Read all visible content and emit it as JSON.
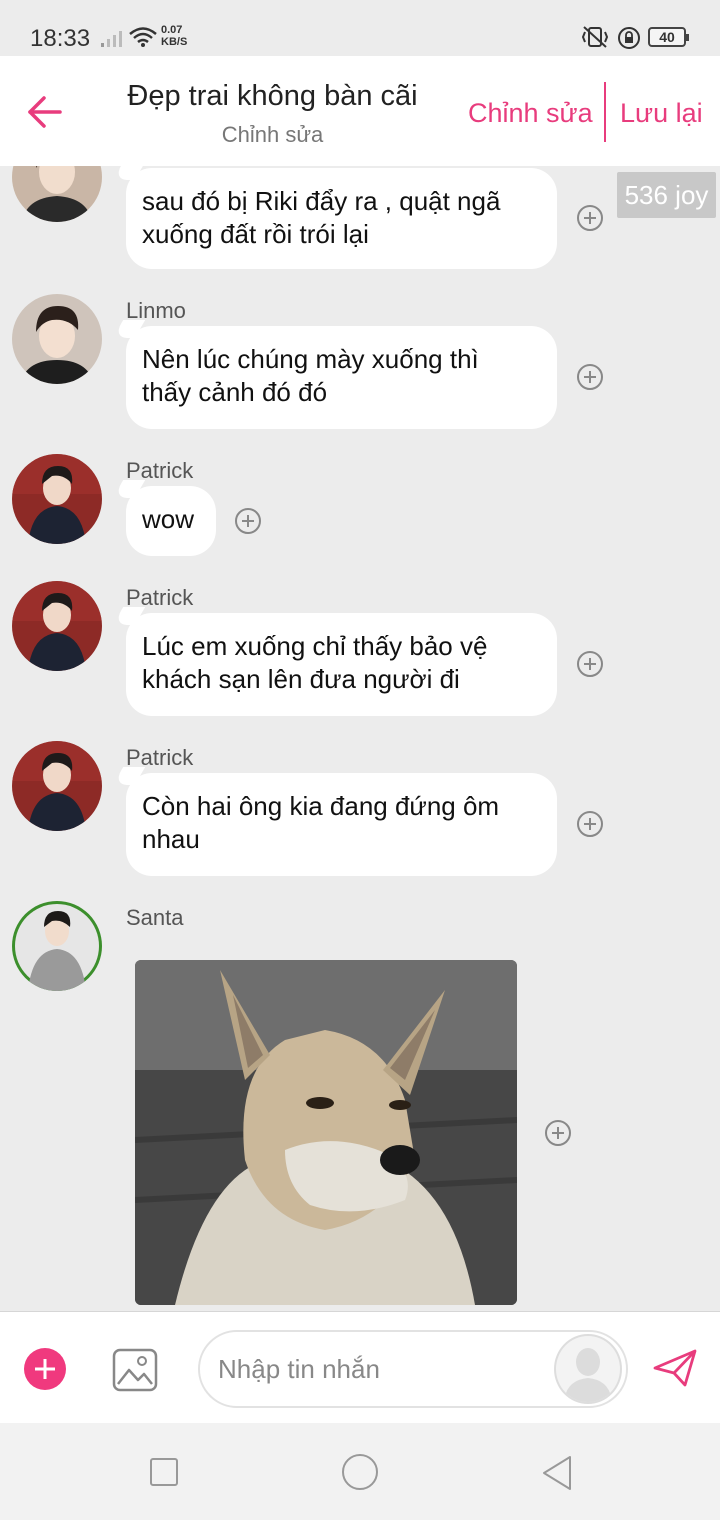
{
  "status_bar": {
    "time": "18:33",
    "net_speed_value": "0.07",
    "net_speed_unit": "KB/S",
    "battery": "40"
  },
  "header": {
    "title": "Đẹp trai không bàn cãi",
    "subtitle": "Chỉnh sửa",
    "edit_label": "Chỉnh sửa",
    "save_label": "Lưu lại"
  },
  "badge": {
    "text": "536 joy"
  },
  "messages": [
    {
      "sender": "",
      "text_line1": "sau đó bị Riki đẩy ra , quật ngã",
      "text_line2": "xuống đất rồi trói lại"
    },
    {
      "sender": "Linmo",
      "text_line1": "Nên lúc chúng mày xuống thì",
      "text_line2": "thấy cảnh đó đó"
    },
    {
      "sender": "Patrick",
      "text_line1": "wow"
    },
    {
      "sender": "Patrick",
      "text_line1": "Lúc em xuống chỉ thấy bảo vệ",
      "text_line2": "khách sạn lên đưa người đi"
    },
    {
      "sender": "Patrick",
      "text_line1": "Còn hai ông kia đang đứng ôm",
      "text_line2": "nhau"
    },
    {
      "sender": "Santa"
    }
  ],
  "input": {
    "placeholder": "Nhập tin nhắn"
  },
  "colors": {
    "accent": "#e83c7d",
    "add_button": "#f0397e",
    "background": "#ececec"
  },
  "icons": {
    "back": "arrow-left-icon",
    "add": "plus-circle-icon",
    "image": "image-icon",
    "send": "send-icon",
    "react": "plus-outline-icon"
  }
}
